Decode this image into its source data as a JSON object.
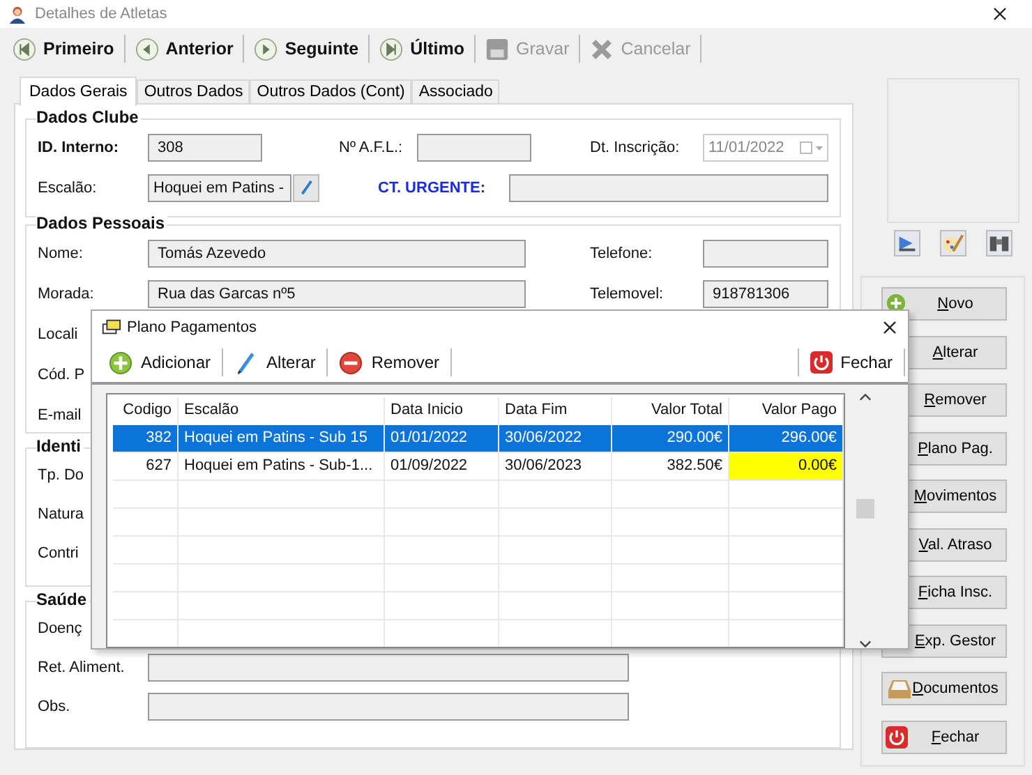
{
  "window": {
    "title": "Detalhes de Atletas"
  },
  "toolbar": [
    {
      "kind": "first",
      "label": "Primeiro",
      "disabled": false
    },
    {
      "kind": "prev",
      "label": "Anterior",
      "disabled": false
    },
    {
      "kind": "next",
      "label": "Seguinte",
      "disabled": false
    },
    {
      "kind": "last",
      "label": "Último",
      "disabled": false
    },
    {
      "kind": "save",
      "label": "Gravar",
      "disabled": true
    },
    {
      "kind": "cancel",
      "label": "Cancelar",
      "disabled": true
    }
  ],
  "tabs": [
    {
      "label": "Dados Gerais",
      "selected": true
    },
    {
      "label": "Outros Dados",
      "selected": false
    },
    {
      "label": "Outros Dados (Cont)",
      "selected": false
    },
    {
      "label": "Associado",
      "selected": false
    }
  ],
  "dados_clube": {
    "title": "Dados Clube",
    "id_label": "ID. Interno:",
    "id_value": "308",
    "afl_label": "Nº A.F.L.:",
    "inscricao_label": "Dt. Inscrição:",
    "inscricao_value": "11/01/2022",
    "escalao_label": "Escalão:",
    "escalao_value": "Hoquei em Patins -",
    "urgente_label": "CT. URGENTE:"
  },
  "dados_pessoais": {
    "title": "Dados Pessoais",
    "nome_label": "Nome:",
    "nome_value": "Tomás  Azevedo",
    "telefone_label": "Telefone:",
    "morada_label": "Morada:",
    "morada_value": "Rua das Garcas nº5",
    "telemovel_label": "Telemovel:",
    "telemovel_value": "918781306",
    "hidden_labels": [
      "Locali",
      "Cód. P",
      "E-mail"
    ]
  },
  "identificacao": {
    "title": "Identi",
    "labels": [
      "Tp. Do",
      "Natura",
      "Contri"
    ]
  },
  "saude": {
    "title": "Saúde",
    "doenca_label": "Doenç",
    "alimentacao_label": "Ret. Aliment.",
    "obs_label": "Obs."
  },
  "side_buttons": [
    {
      "kind": "novo",
      "label": "Novo"
    },
    {
      "kind": "plain",
      "label": "Alterar"
    },
    {
      "kind": "plain",
      "label": "Remover"
    },
    {
      "kind": "plain",
      "label": "Plano Pag."
    },
    {
      "kind": "plain",
      "label": "Movimentos"
    },
    {
      "kind": "plain",
      "label": "Val. Atraso"
    },
    {
      "kind": "plain",
      "label": "Ficha Insc."
    },
    {
      "kind": "plain",
      "label": "Exp. Gestor"
    },
    {
      "kind": "documentos",
      "label": "Documentos"
    },
    {
      "kind": "fechar",
      "label": "Fechar"
    }
  ],
  "dialog": {
    "title": "Plano Pagamentos",
    "toolbar": [
      {
        "kind": "add",
        "label": "Adicionar"
      },
      {
        "kind": "edit",
        "label": "Alterar"
      },
      {
        "kind": "remove",
        "label": "Remover"
      }
    ],
    "close_button": "Fechar",
    "columns": [
      "Codigo",
      "Escalão",
      "Data Inicio",
      "Data Fim",
      "Valor Total",
      "Valor Pago"
    ],
    "rows": [
      {
        "selected": true,
        "paid_alert": false,
        "cells": [
          "382",
          "Hoquei em Patins - Sub 15",
          "01/01/2022",
          "30/06/2022",
          "290.00€",
          "296.00€"
        ]
      },
      {
        "selected": false,
        "paid_alert": true,
        "cells": [
          "627",
          "Hoquei em Patins - Sub-1...",
          "01/09/2022",
          "30/06/2023",
          "382.50€",
          "0.00€"
        ]
      }
    ]
  }
}
